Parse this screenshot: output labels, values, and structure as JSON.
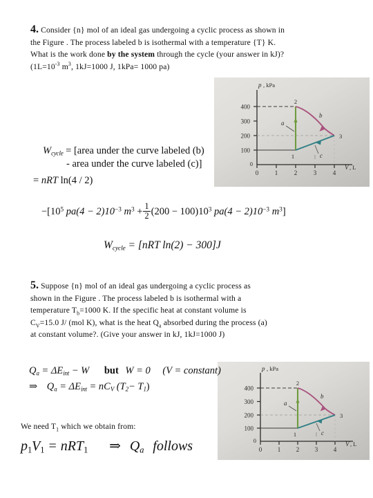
{
  "document": {
    "title": "Thermodynamics cyclic process worked solutions",
    "background_color": "#ffffff",
    "text_color": "#101010"
  },
  "question4": {
    "number": "4.",
    "lines": [
      "Consider {n} mol of an ideal gas undergoing a cyclic process as shown in",
      "the Figure . The process labeled b is isothermal with a temperature {T} K.",
      "What is the work done by the system through the cycle (your answer in kJ)?",
      "(1L=10-3 m3, 1kJ=1000 J,  1kPa= 1000 pa)"
    ],
    "line1_a": "Consider {n} mol of an ideal gas undergoing a cyclic process as shown in",
    "line2": "the Figure . The process labeled b is isothermal with a temperature {T} K.",
    "line3_a": "What is the work done ",
    "line3_bold": "by the system",
    "line3_b": " through the cycle (your answer in kJ)?",
    "line4_a": "(1L=10",
    "line4_sup1": "-3",
    "line4_b": " m",
    "line4_sup2": "3",
    "line4_c": ", 1kJ=1000 J,  1kPa= 1000 pa)"
  },
  "equations4": {
    "l1_lhs_var": "W",
    "l1_lhs_sub": "cycle",
    "l1_rest": "= [area under the curve labeled (b)",
    "l2": "- area under the curve labeled (c)]",
    "l3": "= nRT ln(4 / 2)",
    "l3_var1": "nRT",
    "l3_tail": "ln(4 / 2)",
    "l4_p1": "−[10",
    "l4_sup1": "5",
    "l4_p2": " pa(4 − 2)10",
    "l4_sup2": "−3",
    "l4_p3": " m",
    "l4_sup3": "3",
    "l4_p4": "+",
    "l4_frac_num": "1",
    "l4_frac_den": "2",
    "l4_p5": "(200 − 100)10",
    "l4_sup4": "3",
    "l4_p6": " pa(4 − 2)10",
    "l4_sup5": "−3",
    "l4_p7": " m",
    "l4_sup6": "3",
    "l4_p8": "]",
    "l5_var": "W",
    "l5_sub": "cycle",
    "l5_rest": "= [nRT ln(2) − 300]J"
  },
  "question5": {
    "number": "5.",
    "line1": "Suppose {n} mol of an ideal gas undergoing a cyclic process as",
    "line2": "shown in the Figure . The process labeled b is isothermal with a",
    "line3_a": "temperature T",
    "line3_sub": "b",
    "line3_b": "=1000 K. If the specific heat at constant volume is",
    "line4_a": "C",
    "line4_sub": "V",
    "line4_b": "=15.0 J/ (mol K), what is the heat Q",
    "line4_sub2": "a",
    "line4_c": " absorbed during the process (a)",
    "line5": "at constant volume?. (Give your answer in kJ, 1kJ=1000 J)"
  },
  "equations5": {
    "l1_q": "Q",
    "l1_qsub": "a",
    "l1_eq": "= ΔE",
    "l1_esub": "int",
    "l1_minusw": "− W",
    "l1_but": "but",
    "l1_w0": "W = 0",
    "l1_paren": "(V = constant)",
    "l2_arrow": "⇒",
    "l2_q": "Q",
    "l2_qsub": "a",
    "l2_eq1": "= ΔE",
    "l2_esub": "int",
    "l2_eq2": "= nC",
    "l2_csub": "V",
    "l2_tail_open": "(T",
    "l2_t2sub": "2",
    "l2_minus": "− T",
    "l2_t1sub": "1",
    "l2_close": ")"
  },
  "needline": {
    "text_a": "We need T",
    "sub": "1",
    "text_b": " which we obtain from:"
  },
  "equations6": {
    "p": "p",
    "psub": "1",
    "v": "V",
    "vsub": "1",
    "eq": "= nRT",
    "tsub": "1",
    "arrow": "⇒",
    "q": "Q",
    "qsub": "a",
    "follows": "follows"
  },
  "figure": {
    "caption_axis_y": "p, kPa",
    "caption_axis_x": "V, L",
    "y_ticks": [
      "400",
      "300",
      "200",
      "100",
      "0"
    ],
    "x_ticks": [
      "0",
      "1",
      "2",
      "3",
      "4"
    ],
    "point_labels": [
      "1",
      "2",
      "3"
    ],
    "curve_labels": [
      "a",
      "b",
      "c"
    ],
    "colors": {
      "process_a": "#6f9b3f",
      "process_b": "#a8527e",
      "process_c": "#2f7f85",
      "axis": "#2a2a2a",
      "plate_bg": "#d9d7d4"
    },
    "chart_data": {
      "type": "line",
      "title": "p-V diagram of cyclic process",
      "xlabel": "V, L",
      "ylabel": "p, kPa",
      "xlim": [
        0,
        4.6
      ],
      "ylim": [
        0,
        440
      ],
      "xticks": [
        0,
        1,
        2,
        3,
        4
      ],
      "yticks": [
        0,
        100,
        200,
        300,
        400
      ],
      "grid": false,
      "points": [
        {
          "label": "1",
          "V": 2,
          "p": 100
        },
        {
          "label": "2",
          "V": 2,
          "p": 400
        },
        {
          "label": "3",
          "V": 4,
          "p": 200
        }
      ],
      "series": [
        {
          "name": "a",
          "kind": "isochoric",
          "color": "#6f9b3f",
          "from": "1",
          "to": "2",
          "x": [
            2,
            2
          ],
          "y": [
            100,
            400
          ]
        },
        {
          "name": "b",
          "kind": "isothermal",
          "color": "#a8527e",
          "from": "2",
          "to": "3",
          "x": [
            2.0,
            2.4,
            2.8,
            3.2,
            3.6,
            4.0
          ],
          "y": [
            400,
            333,
            286,
            250,
            222,
            200
          ]
        },
        {
          "name": "c",
          "kind": "linear",
          "color": "#2f7f85",
          "from": "3",
          "to": "1",
          "x": [
            4,
            2
          ],
          "y": [
            200,
            100
          ]
        }
      ]
    }
  }
}
